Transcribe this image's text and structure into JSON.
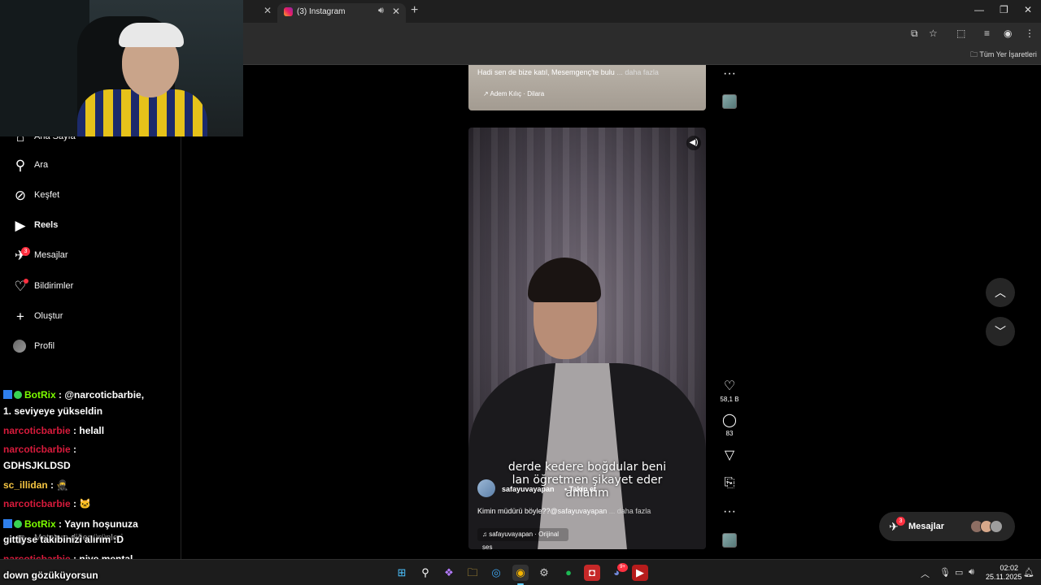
{
  "browser": {
    "tab_title": "(3) Instagram",
    "bookmarks_label": "Tüm Yer İşaretleri"
  },
  "sidebar": {
    "items": [
      {
        "label": "Ana Sayfa",
        "icon": "home-icon"
      },
      {
        "label": "Ara",
        "icon": "search-icon"
      },
      {
        "label": "Keşfet",
        "icon": "compass-icon"
      },
      {
        "label": "Reels",
        "icon": "reels-icon"
      },
      {
        "label": "Mesajlar",
        "icon": "messenger-icon",
        "badge": "3"
      },
      {
        "label": "Bildirimler",
        "icon": "heart-icon"
      },
      {
        "label": "Oluştur",
        "icon": "plus-icon"
      },
      {
        "label": "Profil",
        "icon": "avatar"
      }
    ],
    "meta_label": "Meta'nın diğer ürünleri"
  },
  "chat": [
    {
      "user": "BotRix",
      "text": " : @narcoticbarbie,",
      "color": "#7cfc00"
    },
    {
      "user": "",
      "text": "1. seviyeye yükseldin",
      "color": ""
    },
    {
      "user": "narcoticbarbie",
      "text": " : helall",
      "color": "#d81b3c"
    },
    {
      "user": "narcoticbarbie",
      "text": " :",
      "color": "#d81b3c"
    },
    {
      "user": "",
      "text": "GDHSJKLDSD",
      "color": ""
    },
    {
      "user": "sc_illidan",
      "text": " :",
      "color": "#f5c542"
    },
    {
      "user": "narcoticbarbie",
      "text": " :",
      "color": "#d81b3c"
    },
    {
      "user": "BotRix",
      "text": " : Yayın hoşunuza",
      "color": "#7cfc00"
    },
    {
      "user": "",
      "text": "gittiyse takibinizi alırım :D",
      "color": ""
    },
    {
      "user": "narcoticbarbie",
      "text": " : niye mental",
      "color": "#d81b3c"
    },
    {
      "user": "",
      "text": "down gözüküyorsun",
      "color": ""
    }
  ],
  "prev_post": {
    "caption": "Hadi sen de bize katıl, Mesemgenç'te bulu",
    "more": "... daha fazla",
    "audio": "Adem Kılıç · Dilara"
  },
  "reel": {
    "subtitle_line1": "derde kedere boğdular beni",
    "subtitle_line2": "lan öğretmen şikayet eder",
    "subtitle_line3": "anlarım",
    "username": "safayuvayapan",
    "follow": "•   Takip et",
    "caption": "Kimin müdürü böyle??@safayuvayapan",
    "more": "... daha fazla",
    "audio": "safayuvayapan · Orijinal ses",
    "likes": "58,1 B",
    "comments": "83"
  },
  "messages_pill": {
    "label": "Mesajlar",
    "badge": "3"
  },
  "taskbar": {
    "time": "02:02",
    "date": "25.11.2025",
    "discord_badge": "9+"
  }
}
